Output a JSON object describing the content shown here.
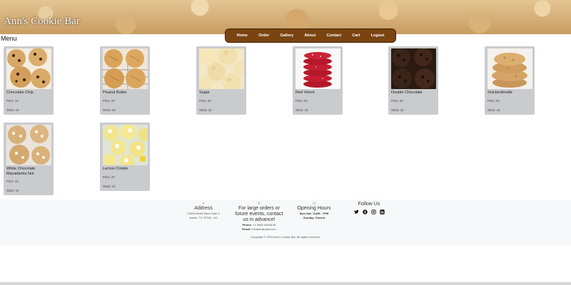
{
  "header": {
    "site_title": "Ann's Cookie Bar",
    "nav": [
      "Home",
      "Order",
      "Gallery",
      "About",
      "Contact",
      "Cart",
      "Logout"
    ]
  },
  "menu": {
    "heading": "Menu",
    "items": [
      {
        "name": "Chocolate Chip",
        "price": "Price: 10",
        "stock": "Stock: 15"
      },
      {
        "name": "Peanut Butter",
        "price": "Price: 20",
        "stock": "Stock: 10"
      },
      {
        "name": "Sugar",
        "price": "Price: 20",
        "stock": "Stock: 10"
      },
      {
        "name": "Red Velvet",
        "price": "Price: 20",
        "stock": "Stock: 10"
      },
      {
        "name": "Double Chocolate",
        "price": "Price: 20",
        "stock": "Stock: 10"
      },
      {
        "name": "Snickerdoodle",
        "price": "Price: 20",
        "stock": "Stock: 15"
      },
      {
        "name": "White Chocolate Macadamia Nut",
        "price": "Price: 20",
        "stock": "Stock: 10"
      },
      {
        "name": "Lemon Crinkle",
        "price": "Price: 20",
        "stock": "Stock: 10"
      }
    ]
  },
  "footer": {
    "address": {
      "title": "Address",
      "line1": "11900 Metric Blvd Suite X",
      "line2": "Austin, TX 78758 - US"
    },
    "contact": {
      "title": "For large orders or future events, contact us in advance!",
      "phone_label": "Phone:",
      "phone": "+1 5589 55488 55",
      "email_label": "Email:",
      "email": "info@example.com"
    },
    "hours": {
      "title": "Opening Hours",
      "weekdays": "Mon-Sat: 11AM - 7PM",
      "sunday": "Sunday: Closed"
    },
    "follow": {
      "title": "Follow Us",
      "icons": [
        "twitter-icon",
        "facebook-icon",
        "instagram-icon",
        "linkedin-icon"
      ]
    },
    "copyright": "Copyright © 2023 Ann's Cookie Bar. All rights reserved."
  },
  "colors": {
    "nav_bg": "#7a4411",
    "card_bg": "#c9cbce",
    "footer_bg": "#f7f8fa"
  }
}
